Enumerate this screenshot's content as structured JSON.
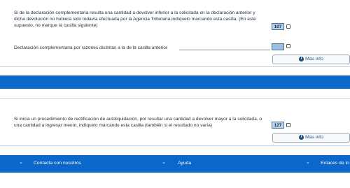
{
  "section1": {
    "text": "Si de la declaración complementaria resulta una cantidad a devolver inferior a la solicitada en la declaración anterior y dicha devolución no hubiera sido todavía efectuada por la Agencia Tributaria,indíquelo marcando esta casilla. (En este supuesto, no marque la casilla siguiente)",
    "box_value": "107",
    "row2_text": "Declaración complementaria por razones distintas a la de la casilla anterior",
    "mas_info_label": "Más info"
  },
  "section2": {
    "text": "Si inicia un procedimiento de rectificación de autoliquidación, por resultar una cantidad a devolver mayor a la solicitada, o una cantidad a ingresar menor, indíquelo marcando esta casilla (también si el resultado no varía)",
    "box_value": "127",
    "mas_info_label": "Más info"
  },
  "footer": {
    "items": [
      {
        "label": "Contacta con nosotros"
      },
      {
        "label": "Ayuda"
      },
      {
        "label": "Enlaces de in"
      }
    ]
  },
  "colors": {
    "accent_blue": "#0b67c9",
    "box_fill": "#bcd5ee"
  },
  "icons": [
    "info-icon",
    "chevron-down-icon"
  ]
}
